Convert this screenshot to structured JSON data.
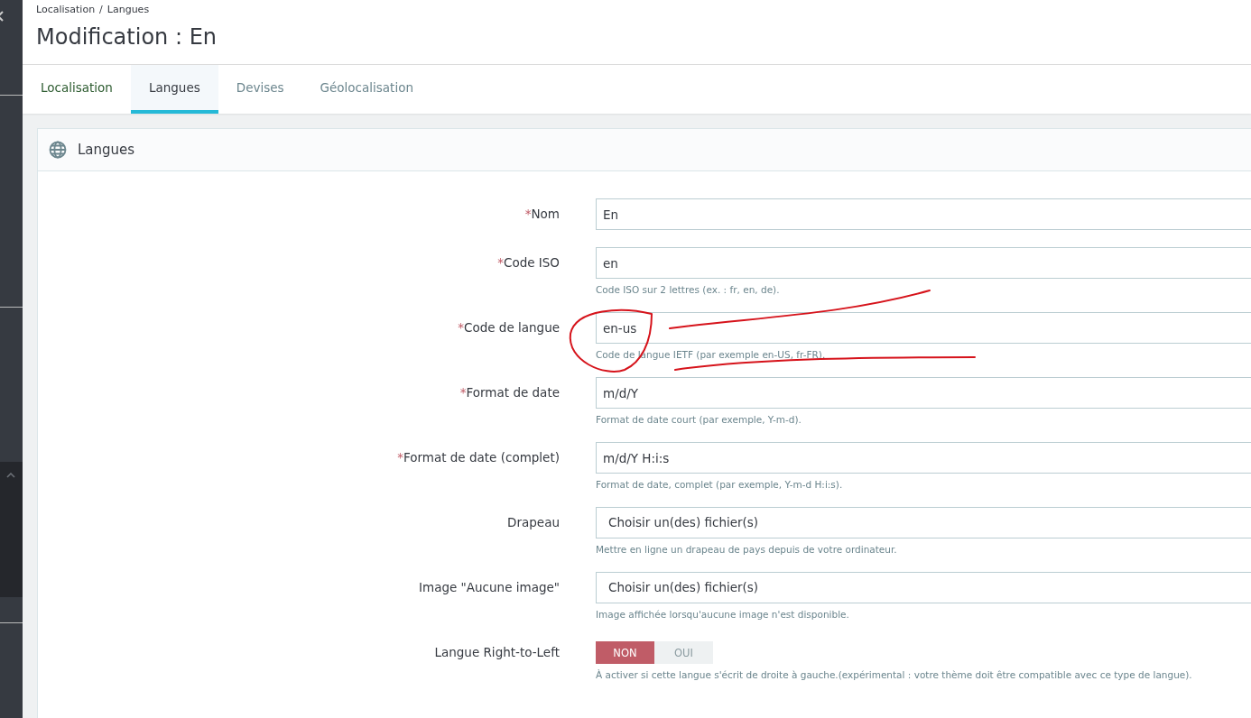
{
  "breadcrumb": [
    "Localisation",
    "Langues"
  ],
  "breadcrumb_separator": "/",
  "title": "Modification : En",
  "tabs": [
    {
      "label": "Localisation",
      "selected": false
    },
    {
      "label": "Langues",
      "selected": true
    },
    {
      "label": "Devises",
      "selected": false
    },
    {
      "label": "Géolocalisation",
      "selected": false
    }
  ],
  "card": {
    "title": "Langues"
  },
  "fields": [
    {
      "kind": "text",
      "label": "Nom",
      "required_mark": "*",
      "value": "En"
    },
    {
      "kind": "text",
      "label": "Code ISO",
      "required_mark": "*",
      "value": "en",
      "help": "Code ISO sur 2 lettres (ex. : fr, en, de)."
    },
    {
      "kind": "text",
      "label": "Code de langue",
      "required_mark": "*",
      "value": "en-us",
      "help": "Code de langue IETF (par exemple en-US, fr-FR)."
    },
    {
      "kind": "text",
      "label": "Format de date",
      "required_mark": "*",
      "value": "m/d/Y",
      "help": "Format de date court (par exemple, Y-m-d)."
    },
    {
      "kind": "text",
      "label": "Format de date (complet)",
      "required_mark": "*",
      "value": "m/d/Y H:i:s",
      "help": "Format de date, complet (par exemple, Y-m-d H:i:s)."
    },
    {
      "kind": "file",
      "label": "Drapeau",
      "value": "Choisir un(des) fichier(s)",
      "help": "Mettre en ligne un drapeau de pays depuis de votre ordinateur."
    },
    {
      "kind": "file",
      "label": "Image \"Aucune image\"",
      "value": "Choisir un(des) fichier(s)",
      "help": "Image affichée lorsqu'aucune image n'est disponible."
    },
    {
      "kind": "switch",
      "label": "Langue Right-to-Left",
      "options": [
        {
          "label": "NON",
          "selected": true
        },
        {
          "label": "OUI",
          "selected": false
        }
      ],
      "help": "À activer si cette langue s'écrit de droite à gauche.(expérimental : votre thème doit être compatible avec ce type de langue)."
    }
  ]
}
